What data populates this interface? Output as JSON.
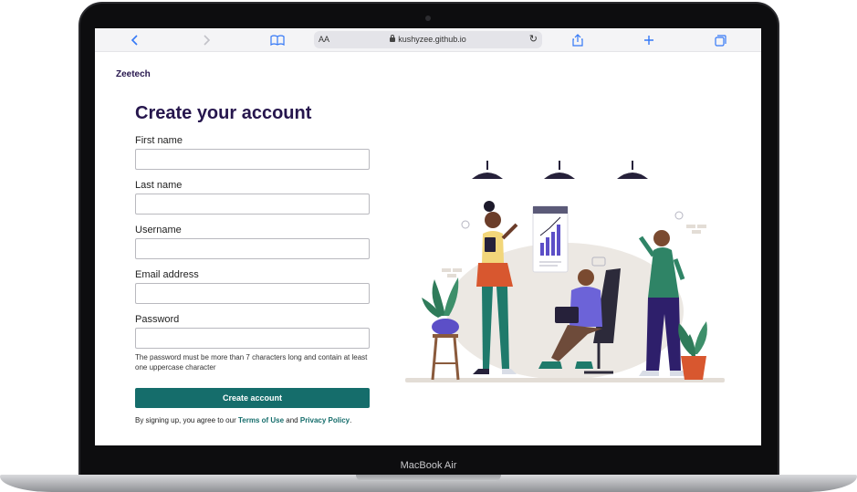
{
  "device": {
    "model_label": "MacBook Air"
  },
  "browser": {
    "aa_label": "AA",
    "url": "kushyzee.github.io",
    "icons": [
      "chevron-left-icon",
      "chevron-right-icon",
      "book-icon",
      "lock-icon",
      "reload-icon",
      "share-icon",
      "plus-icon",
      "tabs-icon"
    ]
  },
  "brand": "Zeetech",
  "form": {
    "title": "Create your account",
    "fields": [
      {
        "label": "First name",
        "value": ""
      },
      {
        "label": "Last name",
        "value": ""
      },
      {
        "label": "Username",
        "value": ""
      },
      {
        "label": "Email address",
        "value": ""
      },
      {
        "label": "Password",
        "value": ""
      }
    ],
    "password_hint": "The password must be more than 7 characters long and contain at least one uppercase character",
    "submit_label": "Create account",
    "terms_prefix": "By signing up, you agree to our ",
    "terms_link": "Terms of Use",
    "terms_and": " and ",
    "privacy_link": "Privacy Policy",
    "terms_suffix": "."
  },
  "colors": {
    "accent": "#156d6b",
    "heading": "#26164d",
    "link": "#3478f6"
  }
}
